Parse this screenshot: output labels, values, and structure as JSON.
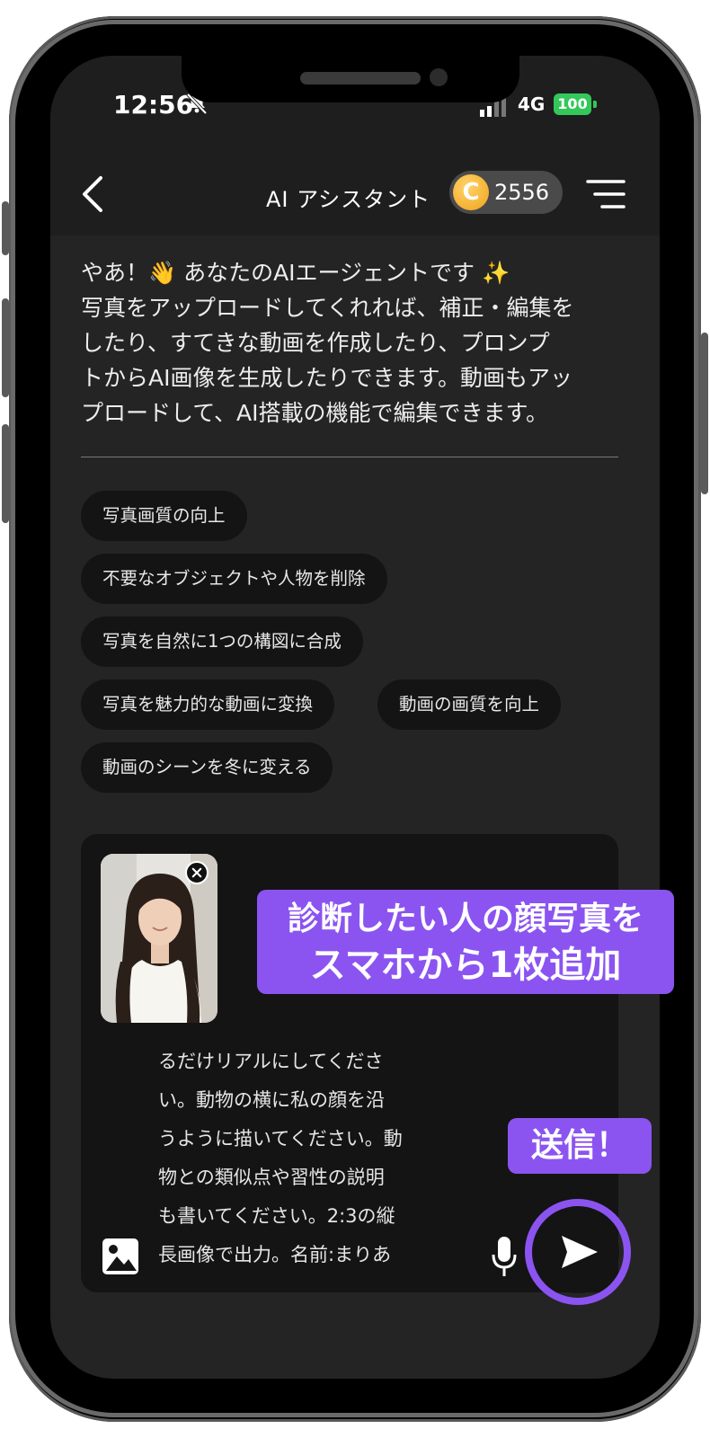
{
  "status_bar": {
    "time": "12:56",
    "network": "4G",
    "battery": "100"
  },
  "header": {
    "title": "AI アシスタント",
    "coin_count": "2556",
    "coin_symbol": "C"
  },
  "intro": {
    "lines": [
      "やあ！👋 あなたのAIエージェントです ✨",
      "写真をアップロードしてくれれば、補正・編集を",
      "したり、すてきな動画を作成したり、プロンプ",
      "トからAI画像を生成したりできます。動画もアッ",
      "プロードして、AI搭載の機能で編集できます。"
    ]
  },
  "suggestions": [
    "写真画質の向上",
    "不要なオブジェクトや人物を削除",
    "写真を自然に1つの構図に合成",
    "写真を魅力的な動画に変換",
    "動画の画質を向上",
    "動画のシーンを冬に変える"
  ],
  "composer": {
    "prompt_lines": [
      "るだけリアルにしてくださ",
      "い。動物の横に私の顔を沿",
      "うように描いてください。動",
      "物との類似点や習性の説明",
      "も書いてください。2:3の縦",
      "長画像で出力。名前:まりあ"
    ]
  },
  "annotations": {
    "upload_line1": "診断したい人の顔写真を",
    "upload_line2": "スマホから1枚追加",
    "send": "送信！"
  },
  "colors": {
    "accent": "#8b54f0",
    "background": "#242424",
    "chip": "#141414"
  }
}
